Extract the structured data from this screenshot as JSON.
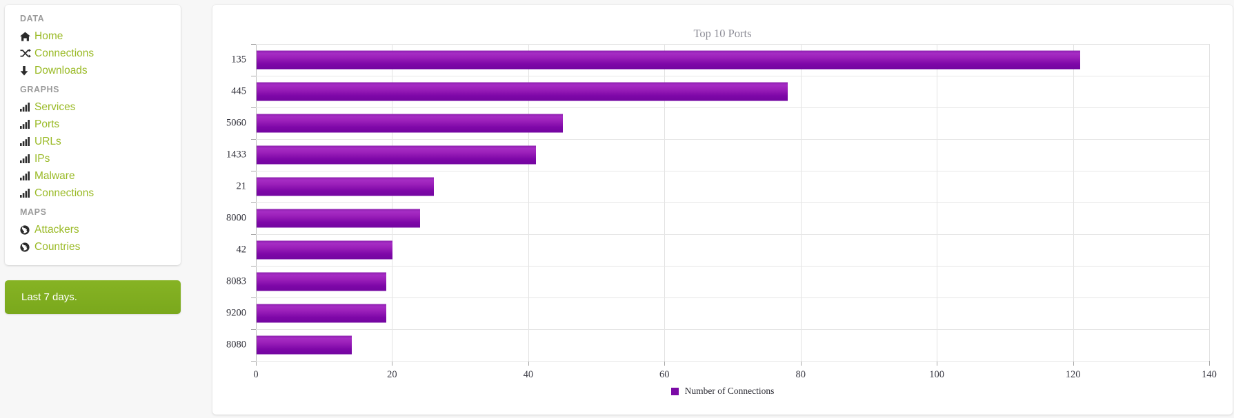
{
  "sidebar": {
    "sections": [
      {
        "heading": "DATA",
        "items": [
          {
            "label": "Home",
            "icon": "home-icon"
          },
          {
            "label": "Connections",
            "icon": "shuffle-icon"
          },
          {
            "label": "Downloads",
            "icon": "download-arrow-icon"
          }
        ]
      },
      {
        "heading": "GRAPHS",
        "items": [
          {
            "label": "Services",
            "icon": "bar-chart-icon"
          },
          {
            "label": "Ports",
            "icon": "bar-chart-icon"
          },
          {
            "label": "URLs",
            "icon": "bar-chart-icon"
          },
          {
            "label": "IPs",
            "icon": "bar-chart-icon"
          },
          {
            "label": "Malware",
            "icon": "bar-chart-icon"
          },
          {
            "label": "Connections",
            "icon": "bar-chart-icon"
          }
        ]
      },
      {
        "heading": "MAPS",
        "items": [
          {
            "label": "Attackers",
            "icon": "globe-icon"
          },
          {
            "label": "Countries",
            "icon": "globe-icon"
          }
        ]
      }
    ],
    "alert": {
      "text": "Last 7 days.",
      "color": "#7aa81c"
    },
    "link_color": "#9aba26",
    "heading_color": "#9b9b9b"
  },
  "chart_data": {
    "type": "bar",
    "orientation": "horizontal",
    "title": "Top 10 Ports",
    "xlabel": "",
    "ylabel": "",
    "categories": [
      "135",
      "445",
      "5060",
      "1433",
      "21",
      "8000",
      "42",
      "8083",
      "9200",
      "8080"
    ],
    "values": [
      121,
      78,
      45,
      41,
      26,
      24,
      20,
      19,
      19,
      14
    ],
    "series": [
      {
        "name": "Number of Connections",
        "values": [
          121,
          78,
          45,
          41,
          26,
          24,
          20,
          19,
          19,
          14
        ],
        "color": "#7b0aa6"
      }
    ],
    "xlim": [
      0,
      140
    ],
    "xticks": [
      0,
      20,
      40,
      60,
      80,
      100,
      120,
      140
    ],
    "xtick_labels": [
      "0",
      "20",
      "40",
      "60",
      "80",
      "100",
      "120",
      "140"
    ],
    "grid": true,
    "legend_position": "bottom",
    "legend": [
      "Number of Connections"
    ],
    "title_color": "#8d8d97",
    "bar_color": "#7b0aa6"
  }
}
